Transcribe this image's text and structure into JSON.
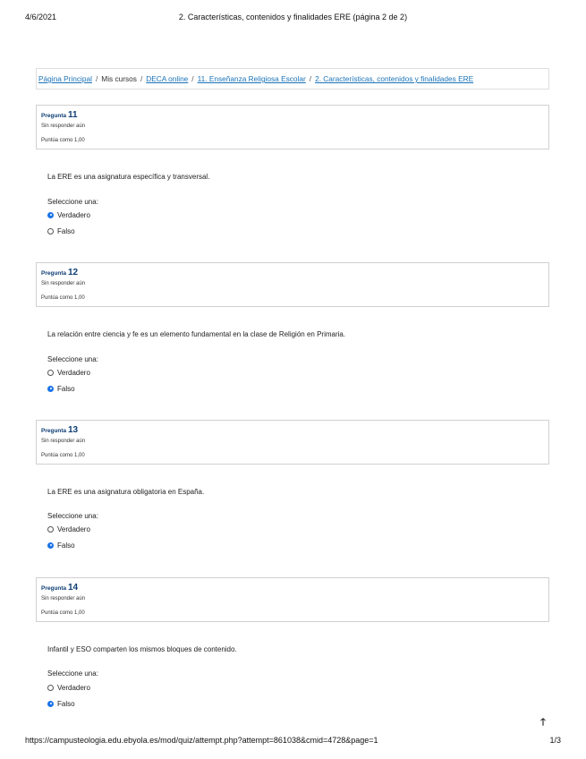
{
  "print_header": {
    "date": "4/6/2021",
    "title": "2. Características, contenidos y finalidades ERE (página 2 de 2)"
  },
  "breadcrumb": [
    {
      "label": "Página Principal",
      "link": true
    },
    {
      "label": "Mis cursos",
      "link": false
    },
    {
      "label": "DECA online",
      "link": true
    },
    {
      "label": "11. Enseñanza Religiosa Escolar",
      "link": true
    },
    {
      "label": "2. Características, contenidos y finalidades ERE",
      "link": true
    }
  ],
  "breadcrumb_separator": "/",
  "questions": [
    {
      "label": "Pregunta",
      "number": "11",
      "state": "Sin responder aún",
      "grade": "Puntúa como 1,00",
      "text": "La ERE es una asignatura específica y transversal.",
      "prompt": "Seleccione una:",
      "options": [
        {
          "label": "Verdadero",
          "checked": true
        },
        {
          "label": "Falso",
          "checked": false
        }
      ]
    },
    {
      "label": "Pregunta",
      "number": "12",
      "state": "Sin responder aún",
      "grade": "Puntúa como 1,00",
      "text": "La relación entre ciencia y fe es un elemento fundamental en la clase de Religión en Primaria.",
      "prompt": "Seleccione una:",
      "options": [
        {
          "label": "Verdadero",
          "checked": false
        },
        {
          "label": "Falso",
          "checked": true
        }
      ]
    },
    {
      "label": "Pregunta",
      "number": "13",
      "state": "Sin responder aún",
      "grade": "Puntúa como 1,00",
      "text": "La ERE es una asignatura obligatoria en España.",
      "prompt": "Seleccione una:",
      "options": [
        {
          "label": "Verdadero",
          "checked": false
        },
        {
          "label": "Falso",
          "checked": true
        }
      ]
    },
    {
      "label": "Pregunta",
      "number": "14",
      "state": "Sin responder aún",
      "grade": "Puntúa como 1,00",
      "text": "Infantil y ESO comparten los mismos bloques de contenido.",
      "prompt": "Seleccione una:",
      "options": [
        {
          "label": "Verdadero",
          "checked": false
        },
        {
          "label": "Falso",
          "checked": true
        }
      ]
    }
  ],
  "back_to_top": {
    "icon": "arrow-up-icon",
    "glyph": "🡑"
  },
  "print_footer": {
    "url": "https://campusteologia.edu.ebyola.es/mod/quiz/attempt.php?attempt=861038&cmid=4728&page=1",
    "page": "1/3"
  }
}
